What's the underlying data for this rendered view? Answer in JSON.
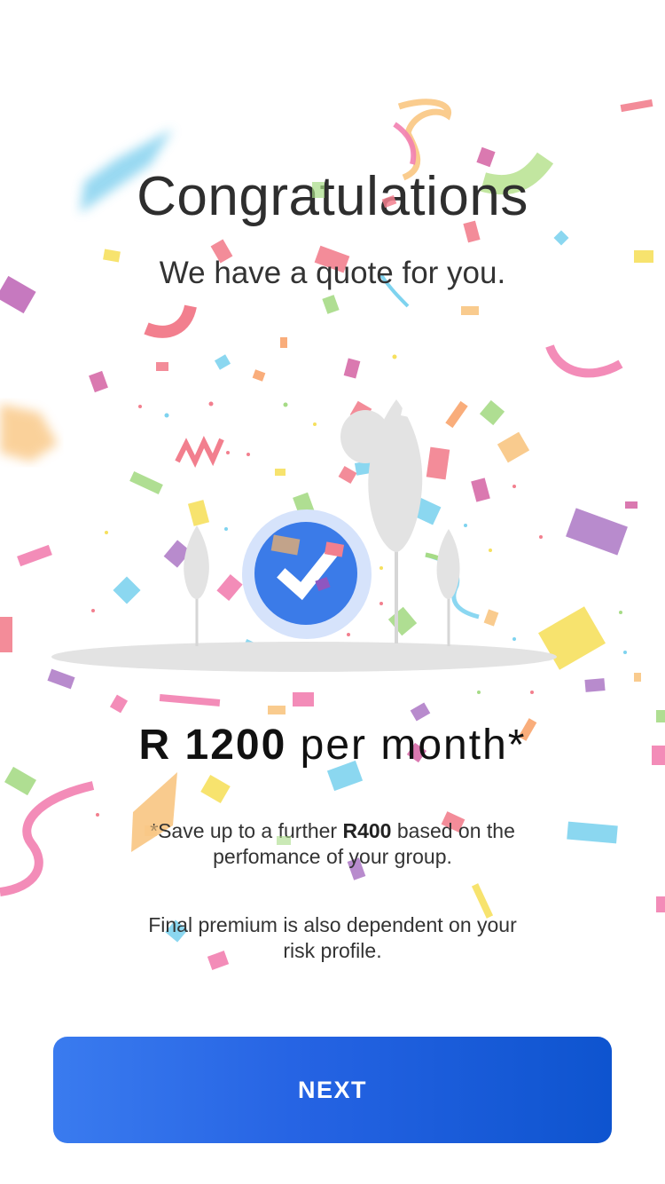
{
  "screen": {
    "title": "Congratulations",
    "subtitle": "We have a quote for you."
  },
  "quote": {
    "amount": "R 1200",
    "period": " per month*"
  },
  "notes": {
    "savings_prefix": "*Save up to a further ",
    "savings_amount": "R400",
    "savings_suffix": " based on the perfomance of your group.",
    "dependency": "Final premium is also dependent on your risk profile."
  },
  "actions": {
    "next_label": "NEXT"
  },
  "colors": {
    "primary": "#2563e3",
    "primary_dark": "#0e54cf",
    "check_badge": "#3b7be8",
    "check_halo": "#d6e3fb"
  },
  "icons": {
    "badge": "check-circle-icon"
  }
}
